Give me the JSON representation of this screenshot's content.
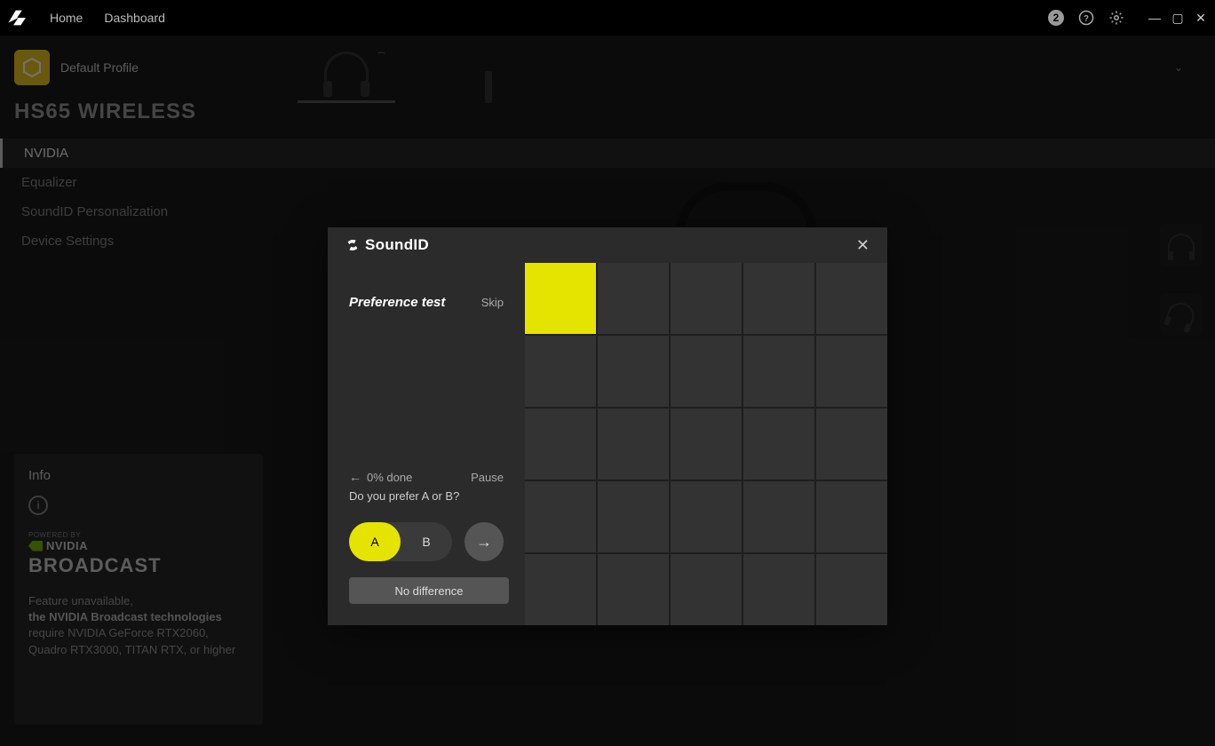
{
  "topbar": {
    "nav": {
      "home": "Home",
      "dashboard": "Dashboard"
    },
    "badge": "2"
  },
  "profile": {
    "name": "Default Profile"
  },
  "device_title": "HS65 WIRELESS",
  "sidebar": {
    "items": [
      {
        "label": "NVIDIA",
        "active": true
      },
      {
        "label": "Equalizer",
        "active": false
      },
      {
        "label": "SoundID Personalization",
        "active": false
      },
      {
        "label": "Device Settings",
        "active": false
      }
    ]
  },
  "info": {
    "title": "Info",
    "powered": "POWERED BY",
    "nvidia": "NVIDIA",
    "broadcast": "BROADCAST",
    "line1": "Feature unavailable,",
    "line2": "the NVIDIA Broadcast technologies",
    "line3": "require NVIDIA GeForce RTX2060, Quadro RTX3000, TITAN RTX, or higher"
  },
  "modal": {
    "brand": "SoundID",
    "pref_title": "Preference test",
    "skip": "Skip",
    "progress": "0% done",
    "pause": "Pause",
    "question": "Do you prefer A or B?",
    "option_a": "A",
    "option_b": "B",
    "no_difference": "No difference",
    "grid_active_index": 0
  }
}
